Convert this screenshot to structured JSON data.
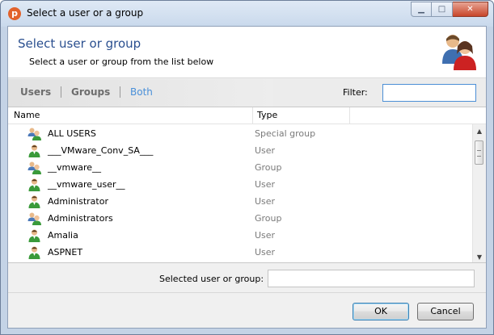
{
  "window": {
    "title": "Select a user or a group"
  },
  "header": {
    "title": "Select user or group",
    "subtitle": "Select a user or group from the list below",
    "icon": "users-icon"
  },
  "tabs": [
    {
      "label": "Users",
      "active": false
    },
    {
      "label": "Groups",
      "active": false
    },
    {
      "label": "Both",
      "active": true
    }
  ],
  "filter": {
    "label": "Filter:",
    "value": ""
  },
  "list": {
    "columns": [
      "Name",
      "Type"
    ],
    "rows": [
      {
        "name": "ALL USERS",
        "type": "Special group",
        "icon": "group-icon"
      },
      {
        "name": "___VMware_Conv_SA___",
        "type": "User",
        "icon": "user-icon"
      },
      {
        "name": "__vmware__",
        "type": "Group",
        "icon": "group-icon"
      },
      {
        "name": "__vmware_user__",
        "type": "User",
        "icon": "user-icon"
      },
      {
        "name": "Administrator",
        "type": "User",
        "icon": "user-icon"
      },
      {
        "name": "Administrators",
        "type": "Group",
        "icon": "group-icon"
      },
      {
        "name": "Amalia",
        "type": "User",
        "icon": "user-icon"
      },
      {
        "name": "ASPNET",
        "type": "User",
        "icon": "user-icon"
      }
    ]
  },
  "selected": {
    "label": "Selected user or group:",
    "value": ""
  },
  "buttons": {
    "ok": "OK",
    "cancel": "Cancel"
  },
  "colors": {
    "accent": "#2a4f8f",
    "active_tab": "#4a90d9",
    "user_green": "#3a9a3a",
    "group_blue": "#4a78b8"
  }
}
